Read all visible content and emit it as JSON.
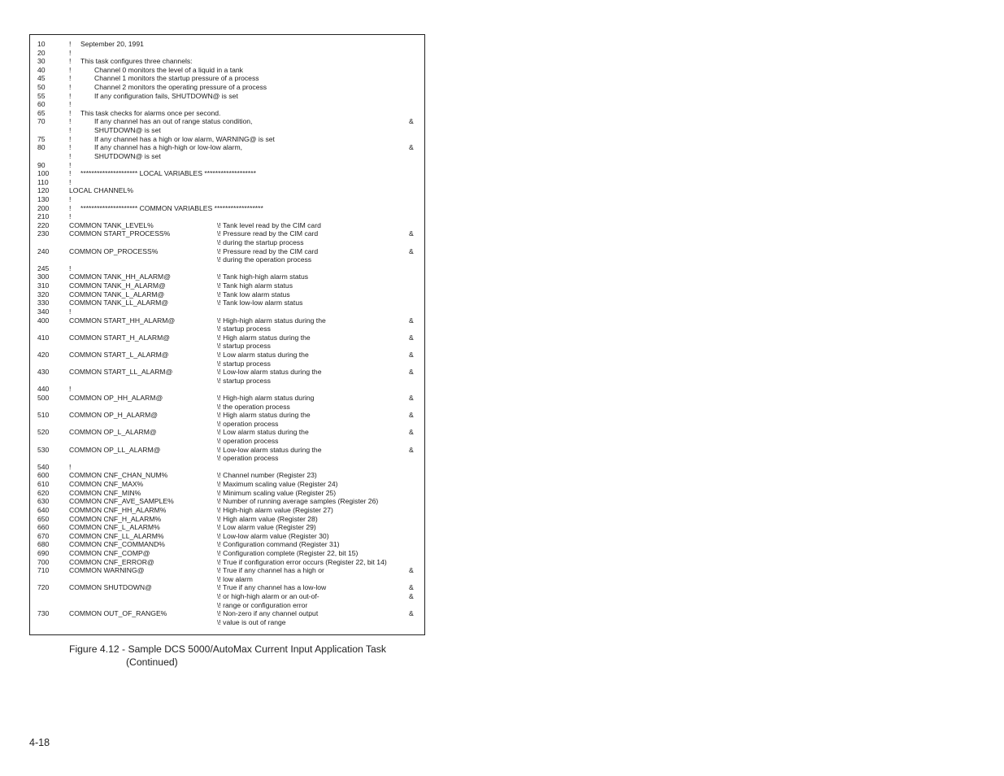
{
  "listing": {
    "lines": [
      {
        "num": "10",
        "bang": "!",
        "text": "September 20, 1991",
        "indent": false
      },
      {
        "num": "20",
        "bang": "!"
      },
      {
        "num": "30",
        "bang": "!",
        "text": "This task configures three channels:",
        "indent": false
      },
      {
        "num": "40",
        "bang": "!",
        "text": "Channel 0 monitors the level of a liquid in a tank",
        "indent": true
      },
      {
        "num": "45",
        "bang": "!",
        "text": "Channel 1 monitors the startup pressure of a process",
        "indent": true
      },
      {
        "num": "50",
        "bang": "!",
        "text": "Channel 2 monitors the operating pressure of a process",
        "indent": true
      },
      {
        "num": "55",
        "bang": "!",
        "text": "If any configuration fails, SHUTDOWN@ is set",
        "indent": true
      },
      {
        "num": "60",
        "bang": "!"
      },
      {
        "num": "65",
        "bang": "!",
        "text": "This task checks for alarms once per second.",
        "indent": false
      },
      {
        "num": "70",
        "bang": "!",
        "text": "If any channel has an out of range status condition,",
        "indent": true,
        "amp": "&"
      },
      {
        "num": "",
        "bang": "!",
        "text": "SHUTDOWN@ is set",
        "indent": true
      },
      {
        "num": "75",
        "bang": "!",
        "text": "If any channel has a high or low alarm, WARNING@ is set",
        "indent": true
      },
      {
        "num": "80",
        "bang": "!",
        "text": "If any channel has a high-high or low-low alarm,",
        "indent": true,
        "amp": "&"
      },
      {
        "num": "",
        "bang": "!",
        "text": "SHUTDOWN@ is set",
        "indent": true
      },
      {
        "num": "90",
        "bang": "!"
      },
      {
        "num": "100",
        "bang": "!",
        "text": "********************* LOCAL VARIABLES *******************",
        "indent": false
      },
      {
        "num": "110",
        "bang": "!"
      },
      {
        "num": "120",
        "code": "LOCAL CHANNEL%"
      },
      {
        "num": "130",
        "bang": "!"
      },
      {
        "num": "200",
        "bang": "!",
        "text": "********************* COMMON VARIABLES ******************",
        "indent": false
      },
      {
        "num": "210",
        "bang": "!"
      },
      {
        "num": "220",
        "code": "COMMON TANK_LEVEL%",
        "rem": "\\! Tank level read by the CIM card"
      },
      {
        "num": "230",
        "code": "COMMON START_PROCESS%",
        "rem": "\\! Pressure read by the CIM card",
        "amp": "&"
      },
      {
        "num": "",
        "rem": "\\! during the startup process"
      },
      {
        "num": "240",
        "code": "COMMON OP_PROCESS%",
        "rem": "\\! Pressure read by the CIM card",
        "amp": "&"
      },
      {
        "num": "",
        "rem": "\\! during the operation process"
      },
      {
        "num": "245",
        "bang": "!"
      },
      {
        "num": "300",
        "code": "COMMON TANK_HH_ALARM@",
        "rem": "\\! Tank high-high alarm status"
      },
      {
        "num": "310",
        "code": "COMMON TANK_H_ALARM@",
        "rem": "\\! Tank high alarm status"
      },
      {
        "num": "320",
        "code": "COMMON TANK_L_ALARM@",
        "rem": "\\! Tank low alarm status"
      },
      {
        "num": "330",
        "code": "COMMON TANK_LL_ALARM@",
        "rem": "\\! Tank low-low alarm status"
      },
      {
        "num": "340",
        "bang": "!"
      },
      {
        "num": "400",
        "code": "COMMON START_HH_ALARM@",
        "rem": "\\! High-high alarm status during the",
        "amp": "&"
      },
      {
        "num": "",
        "rem": "\\! startup process"
      },
      {
        "num": "410",
        "code": "COMMON START_H_ALARM@",
        "rem": "\\! High alarm status during the",
        "amp": "&"
      },
      {
        "num": "",
        "rem": "\\! startup process"
      },
      {
        "num": "420",
        "code": "COMMON START_L_ALARM@",
        "rem": "\\! Low alarm status during the",
        "amp": "&"
      },
      {
        "num": "",
        "rem": "\\! startup process"
      },
      {
        "num": "430",
        "code": "COMMON START_LL_ALARM@",
        "rem": "\\! Low-low alarm status during the",
        "amp": "&"
      },
      {
        "num": "",
        "rem": "\\! startup process"
      },
      {
        "num": "440",
        "bang": "!"
      },
      {
        "num": "500",
        "code": "COMMON OP_HH_ALARM@",
        "rem": "\\! High-high alarm status during",
        "amp": "&"
      },
      {
        "num": "",
        "rem": "\\! the operation process"
      },
      {
        "num": "510",
        "code": "COMMON OP_H_ALARM@",
        "rem": "\\! High alarm status during the",
        "amp": "&"
      },
      {
        "num": "",
        "rem": "\\! operation process"
      },
      {
        "num": "520",
        "code": "COMMON OP_L_ALARM@",
        "rem": "\\! Low alarm status during the",
        "amp": "&"
      },
      {
        "num": "",
        "rem": "\\! operation process"
      },
      {
        "num": "530",
        "code": "COMMON OP_LL_ALARM@",
        "rem": "\\! Low-low alarm status during the",
        "amp": "&"
      },
      {
        "num": "",
        "rem": "\\! operation process"
      },
      {
        "num": "540",
        "bang": "!"
      },
      {
        "num": "600",
        "code": "COMMON CNF_CHAN_NUM%",
        "rem": "\\! Channel number (Register 23)"
      },
      {
        "num": "610",
        "code": "COMMON CNF_MAX%",
        "rem": "\\! Maximum scaling value (Register 24)"
      },
      {
        "num": "620",
        "code": "COMMON CNF_MIN%",
        "rem": "\\! Minimum scaling value (Register 25)"
      },
      {
        "num": "630",
        "code": "COMMON CNF_AVE_SAMPLE%",
        "rem": "\\! Number of running average samples (Register 26)"
      },
      {
        "num": "640",
        "code": "COMMON CNF_HH_ALARM%",
        "rem": "\\! High-high alarm value (Register 27)"
      },
      {
        "num": "650",
        "code": "COMMON CNF_H_ALARM%",
        "rem": "\\! High alarm value (Register 28)"
      },
      {
        "num": "660",
        "code": "COMMON CNF_L_ALARM%",
        "rem": "\\! Low alarm value (Register 29)"
      },
      {
        "num": "670",
        "code": "COMMON CNF_LL_ALARM%",
        "rem": "\\! Low-low alarm value (Register 30)"
      },
      {
        "num": "680",
        "code": "COMMON CNF_COMMAND%",
        "rem": "\\! Configuration command (Register 31)"
      },
      {
        "num": "690",
        "code": "COMMON CNF_COMP@",
        "rem": "\\! Configuration complete (Register 22, bit 15)"
      },
      {
        "num": "700",
        "code": "COMMON CNF_ERROR@",
        "rem": "\\! True if configuration error occurs (Register 22, bit 14)"
      },
      {
        "num": "710",
        "code": "COMMON WARNING@",
        "rem": "\\! True if any channel has a high or",
        "amp": "&"
      },
      {
        "num": "",
        "rem": "\\! low alarm"
      },
      {
        "num": "720",
        "code": "COMMON SHUTDOWN@",
        "rem": "\\! True if any channel has a low-low",
        "amp": "&"
      },
      {
        "num": "",
        "rem": "\\! or high-high alarm or an out-of-",
        "amp": "&"
      },
      {
        "num": "",
        "rem": "\\! range or configuration error"
      },
      {
        "num": "730",
        "code": "COMMON OUT_OF_RANGE%",
        "rem": "\\! Non-zero if any channel output",
        "amp": "&"
      },
      {
        "num": "",
        "rem": "\\! value is out of range"
      }
    ]
  },
  "caption": {
    "line1": "Figure 4.12 - Sample DCS 5000/AutoMax Current Input Application Task",
    "line2": "(Continued)"
  },
  "page_number": "4-18"
}
